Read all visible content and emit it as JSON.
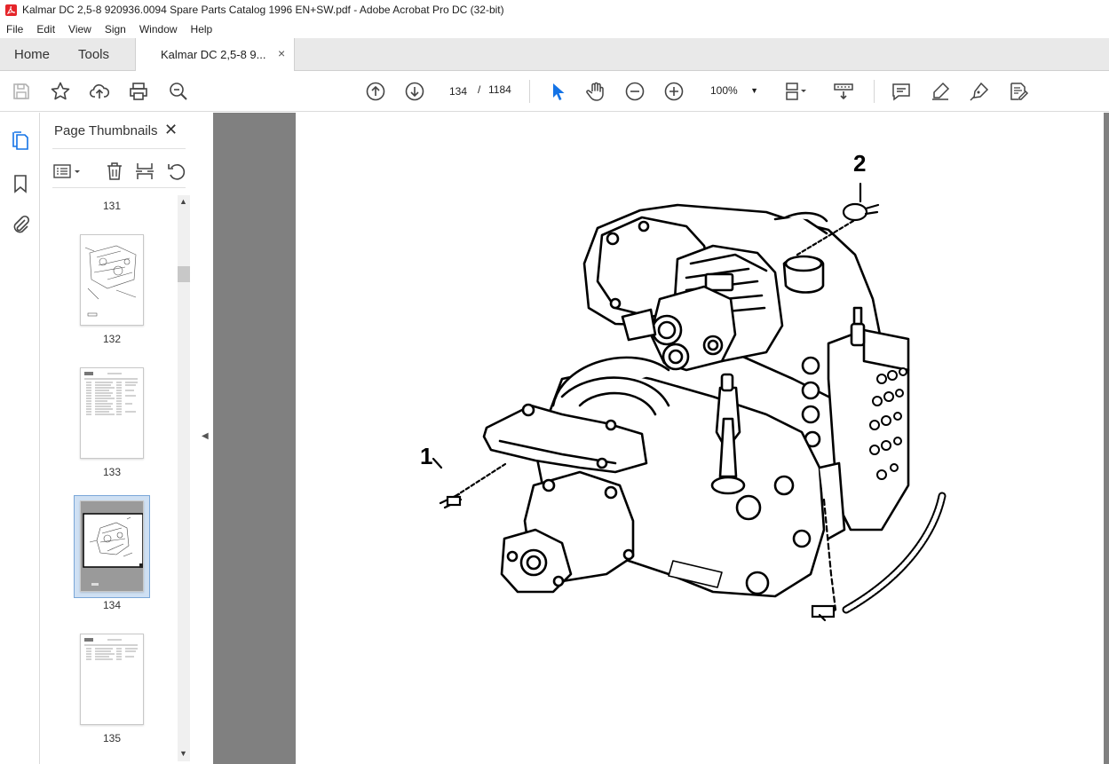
{
  "window": {
    "title": "Kalmar DC 2,5-8 920936.0094 Spare Parts Catalog 1996 EN+SW.pdf - Adobe Acrobat Pro DC (32-bit)"
  },
  "menu": [
    "File",
    "Edit",
    "View",
    "Sign",
    "Window",
    "Help"
  ],
  "tabs": {
    "home": "Home",
    "tools": "Tools",
    "document": "Kalmar DC 2,5-8 9...",
    "close": "×"
  },
  "toolbar": {
    "current_page": "134",
    "separator": "/",
    "total_pages": "1184",
    "zoom": "100%"
  },
  "panel": {
    "title": "Page Thumbnails",
    "close": "✕",
    "thumbnails": [
      {
        "label": "131"
      },
      {
        "label": "132"
      },
      {
        "label": "133"
      },
      {
        "label": "134",
        "selected": true
      },
      {
        "label": "135"
      }
    ]
  },
  "drawing": {
    "callout_1": "1",
    "callout_2": "2"
  },
  "colors": {
    "accent": "#1473e6",
    "selection": "#cfe0f3",
    "doc_background": "#808080"
  }
}
